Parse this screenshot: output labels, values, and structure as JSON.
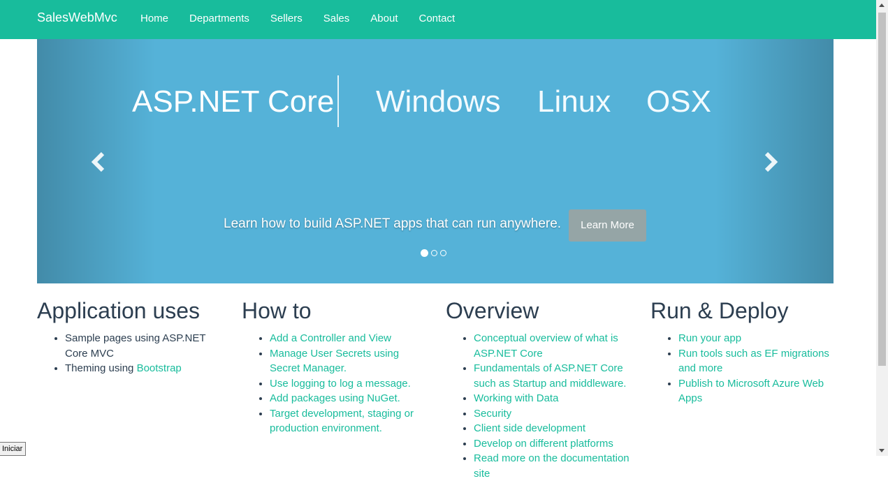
{
  "navbar": {
    "brand": "SalesWebMvc",
    "items": [
      "Home",
      "Departments",
      "Sellers",
      "Sales",
      "About",
      "Contact"
    ],
    "color": "#18bc9c"
  },
  "carousel": {
    "words": [
      "ASP.NET Core",
      "Windows",
      "Linux",
      "OSX"
    ],
    "caption": "Learn how to build ASP.NET apps that can run anywhere.",
    "button_label": "Learn More",
    "slide_count": 3,
    "active_slide": 1,
    "background": "#55b2d8"
  },
  "columns": [
    {
      "title": "Application uses",
      "items": [
        {
          "text": "Sample pages using ASP.NET Core MVC"
        },
        {
          "text": "Theming using ",
          "link": "Bootstrap"
        }
      ]
    },
    {
      "title": "How to",
      "items": [
        {
          "link": "Add a Controller and View"
        },
        {
          "link": "Manage User Secrets using Secret Manager."
        },
        {
          "link": "Use logging to log a message."
        },
        {
          "link": "Add packages using NuGet."
        },
        {
          "link": "Target development, staging or production environment."
        }
      ]
    },
    {
      "title": "Overview",
      "items": [
        {
          "link": "Conceptual overview of what is ASP.NET Core"
        },
        {
          "link": "Fundamentals of ASP.NET Core such as Startup and middleware."
        },
        {
          "link": "Working with Data"
        },
        {
          "link": "Security"
        },
        {
          "link": "Client side development"
        },
        {
          "link": "Develop on different platforms"
        },
        {
          "link": "Read more on the documentation site"
        }
      ]
    },
    {
      "title": "Run & Deploy",
      "items": [
        {
          "link": "Run your app"
        },
        {
          "link": "Run tools such as EF migrations and more"
        },
        {
          "link": "Publish to Microsoft Azure Web Apps"
        }
      ]
    }
  ],
  "status_tip": "Iniciar",
  "link_color": "#18bc9c"
}
